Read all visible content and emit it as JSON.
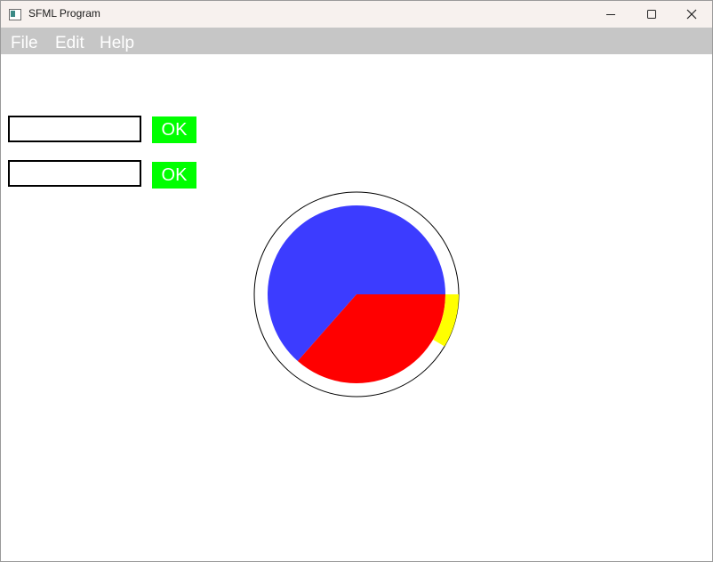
{
  "window": {
    "title": "SFML Program",
    "controls": [
      "minimize-icon",
      "maximize-icon",
      "close-icon"
    ]
  },
  "menu": {
    "items": [
      "File",
      "Edit",
      "Help"
    ]
  },
  "form": {
    "rows": [
      {
        "input_value": "",
        "button_label": "OK"
      },
      {
        "input_value": "",
        "button_label": "OK"
      }
    ]
  },
  "colors": {
    "menubar": "#c6c6c6",
    "button": "#00ff00",
    "slice_blue": "#3c3cff",
    "slice_red": "#ff0000",
    "slice_yellow": "#ffff00",
    "ring": "#000000"
  },
  "chart_data": {
    "type": "pie",
    "values": [
      62,
      33,
      5
    ],
    "colors": [
      "#3c3cff",
      "#ff0000",
      "#ffff00"
    ]
  }
}
